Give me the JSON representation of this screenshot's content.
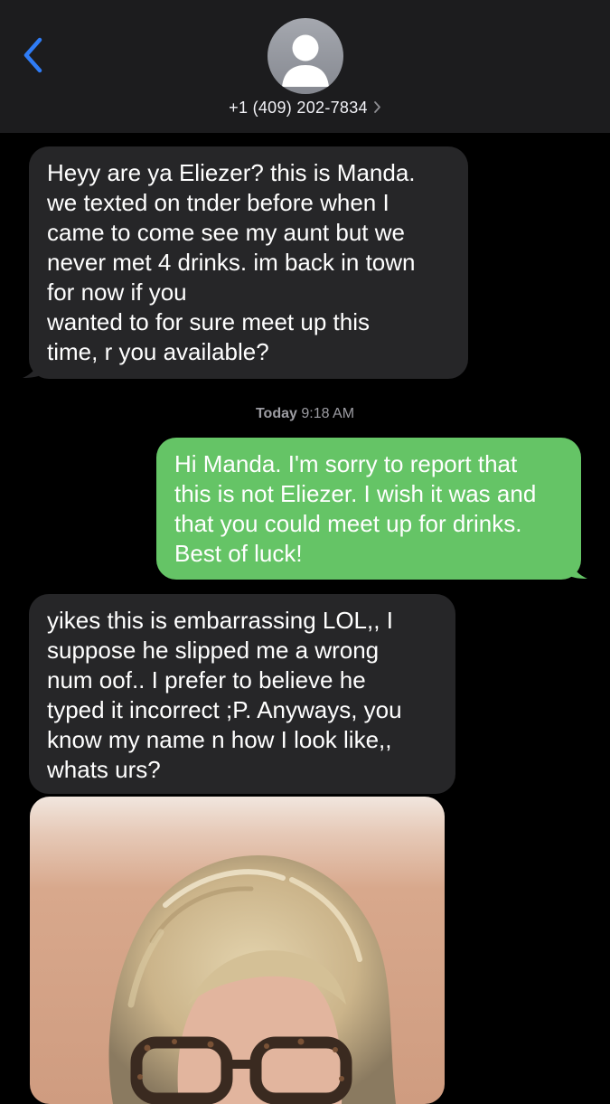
{
  "header": {
    "back_icon": "chevron-left-icon",
    "avatar_icon": "person-silhouette-icon",
    "contact_number": "+1 (409) 202-7834",
    "contact_chevron_icon": "chevron-right-icon",
    "background_color": "#1c1c1e",
    "accent_color": "#2f7cf6"
  },
  "messages": [
    {
      "direction": "incoming",
      "lines": [
        "Heyy are ya Eliezer? this is Manda.",
        "we texted on tnder before when I",
        "came to come see my aunt but we",
        "never met 4 drinks. im back in town",
        "for now if you",
        "wanted to for sure meet up this",
        "time, r you available?"
      ]
    },
    {
      "direction": "outgoing",
      "lines": [
        "Hi Manda. I'm sorry to report that",
        "this is not Eliezer. I wish it was and",
        "that you could meet up for drinks.",
        "Best of luck!"
      ]
    },
    {
      "direction": "incoming",
      "lines": [
        "yikes this is embarrassing LOL,, I",
        "suppose he slipped me a wrong",
        "num oof.. I prefer to believe he",
        "typed it incorrect ;P. Anyways, you",
        "know my name n how I look like,,",
        "whats urs?"
      ]
    }
  ],
  "timestamp": {
    "day": "Today",
    "time": "9:18 AM"
  },
  "photo_attachment": {
    "kind": "photo",
    "subject_icon": "selfie-photo"
  },
  "colors": {
    "incoming_bubble": "#262628",
    "outgoing_bubble": "#65c466",
    "background": "#000000"
  }
}
